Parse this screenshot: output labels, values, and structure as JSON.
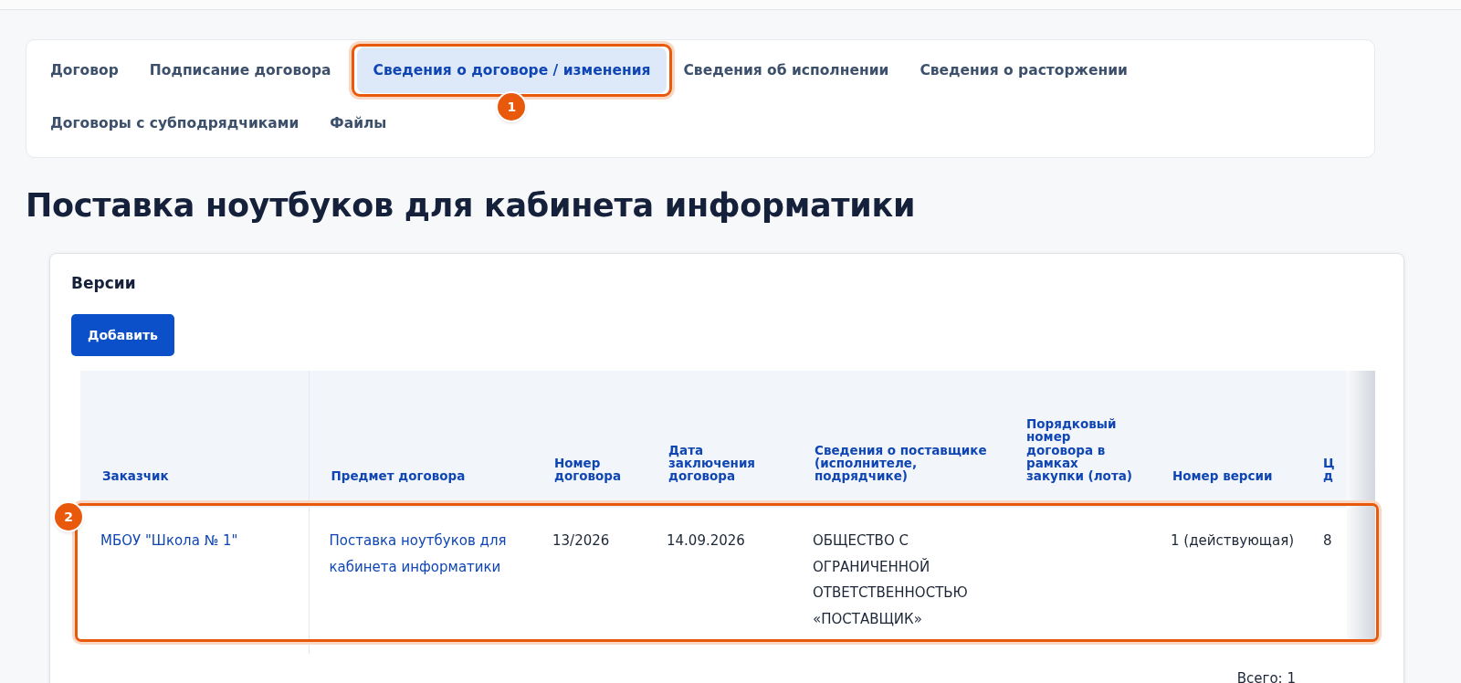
{
  "tabs": [
    {
      "label": "Договор",
      "selected": false,
      "highlighted": false
    },
    {
      "label": "Подписание договора",
      "selected": false,
      "highlighted": false
    },
    {
      "label": "Сведения о договоре / изменения",
      "selected": true,
      "highlighted": true,
      "badge": "1"
    },
    {
      "label": "Сведения об исполнении",
      "selected": false,
      "highlighted": false
    },
    {
      "label": "Сведения о расторжении",
      "selected": false,
      "highlighted": false
    },
    {
      "label": "Договоры с субподрядчиками",
      "selected": false,
      "highlighted": false
    },
    {
      "label": "Файлы",
      "selected": false,
      "highlighted": false
    }
  ],
  "page_title": "Поставка ноутбуков для кабинета информатики",
  "versions": {
    "title": "Версии",
    "add_button": "Добавить",
    "table": {
      "columns": [
        "Заказчик",
        "Предмет договора",
        "Номер договора",
        "Дата заключения договора",
        "Сведения о поставщике (исполнителе, подрядчике)",
        "Порядковый номер договора в рамках закупки (лота)",
        "Номер версии",
        "Ц д"
      ],
      "rows": [
        {
          "highlighted": true,
          "badge": "2",
          "cells": [
            {
              "text": "МБОУ \"Школа № 1\"",
              "link": true
            },
            {
              "text": "Поставка ноутбуков для кабинета информатики",
              "link": true
            },
            {
              "text": "13/2026",
              "link": false
            },
            {
              "text": "14.09.2026",
              "link": false
            },
            {
              "text": "ОБЩЕСТВО С ОГРАНИЧЕННОЙ ОТВЕТСТВЕННОСТЬЮ «ПОСТАВЩИК»",
              "link": false
            },
            null,
            {
              "text": "1 (действующая)",
              "link": false
            },
            {
              "text": "8",
              "link": false
            }
          ]
        }
      ]
    },
    "total": "Всего: 1"
  }
}
